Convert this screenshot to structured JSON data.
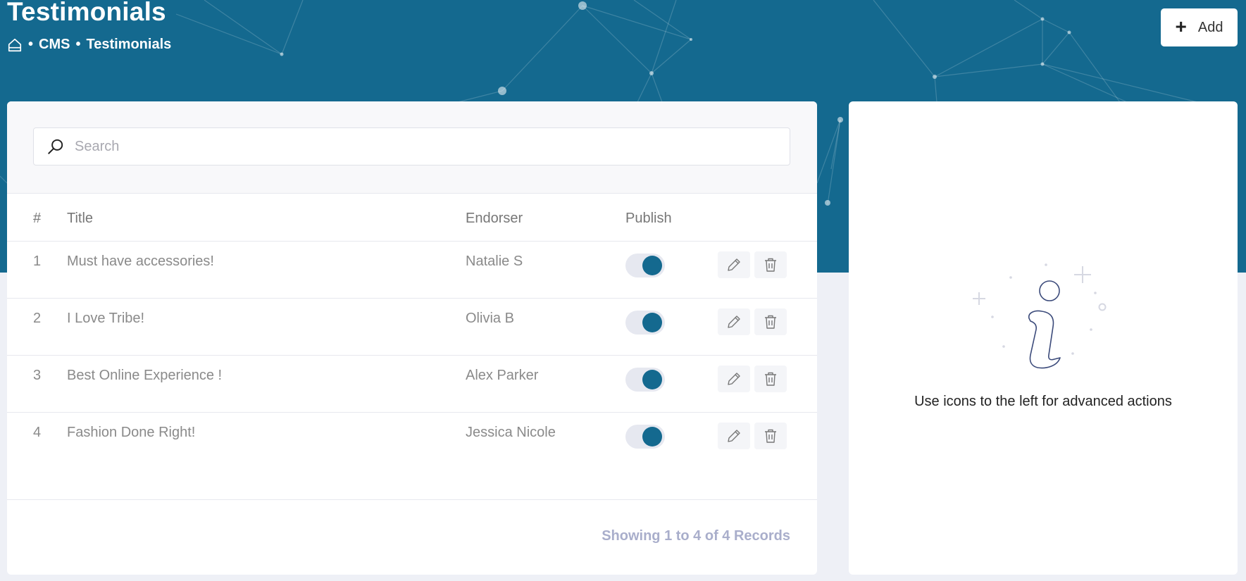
{
  "header": {
    "title": "Testimonials",
    "breadcrumb": [
      "CMS",
      "Testimonials"
    ],
    "breadcrumb_separator": "•",
    "add_label": "Add"
  },
  "search": {
    "placeholder": "Search",
    "value": ""
  },
  "table": {
    "columns": [
      "#",
      "Title",
      "Endorser",
      "Publish"
    ],
    "rows": [
      {
        "num": "1",
        "title": "Must have accessories!",
        "endorser": "Natalie S",
        "published": true
      },
      {
        "num": "2",
        "title": "I Love Tribe!",
        "endorser": "Olivia B",
        "published": true
      },
      {
        "num": "3",
        "title": "Best Online Experience !",
        "endorser": "Alex Parker",
        "published": true
      },
      {
        "num": "4",
        "title": "Fashion Done Right!",
        "endorser": "Jessica Nicole",
        "published": true
      }
    ],
    "footer": "Showing 1 to 4 of 4 Records"
  },
  "info_panel": {
    "text": "Use icons to the left for advanced actions"
  },
  "icons": {
    "home": "home-icon",
    "add": "plus-icon",
    "search": "search-icon",
    "edit": "pencil-icon",
    "delete": "trash-icon",
    "info": "info-icon"
  },
  "colors": {
    "header_bg": "#14698f",
    "accent": "#14698f",
    "page_bg": "#eef0f6",
    "records_text": "#a9aecb"
  }
}
